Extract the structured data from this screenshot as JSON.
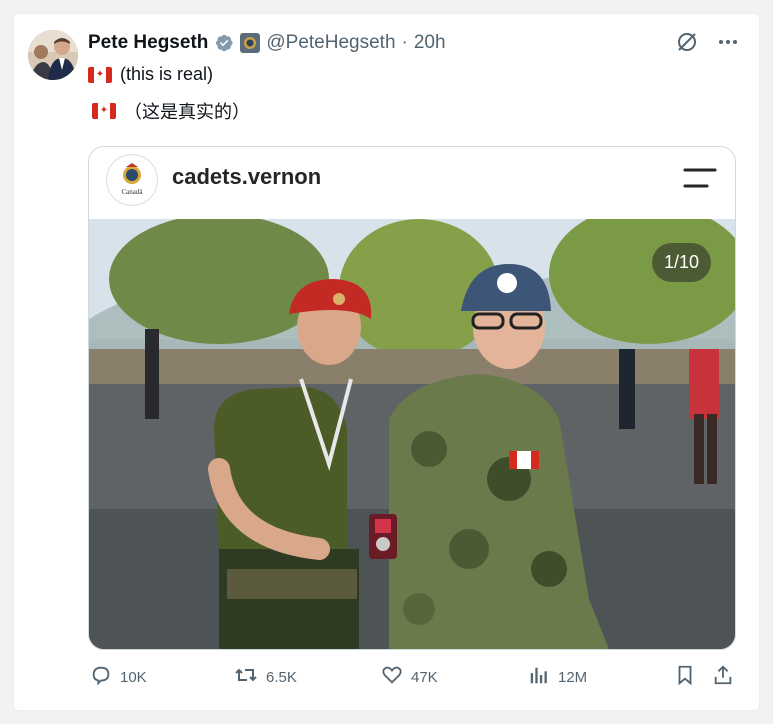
{
  "tweet": {
    "author_name": "Pete Hegseth",
    "handle": "@PeteHegseth",
    "separator": "·",
    "time": "20h",
    "text": "(this is real)",
    "translation": "（这是真实的）"
  },
  "embed": {
    "account_name": "cadets.vernon",
    "logo_text": "Canadä",
    "slide_counter": "1/10"
  },
  "actions": {
    "replies": "10K",
    "reposts": "6.5K",
    "likes": "47K",
    "views": "12M"
  },
  "colors": {
    "text_primary": "#0f1419",
    "text_secondary": "#536471",
    "verified_badge": "#829aab",
    "flag_red": "#d52b1e",
    "border": "#cfd9de"
  },
  "icons": [
    "verified-badge-icon",
    "grok-icon",
    "more-icon",
    "menu-icon",
    "reply-icon",
    "repost-icon",
    "like-icon",
    "views-icon",
    "bookmark-icon",
    "share-icon"
  ]
}
